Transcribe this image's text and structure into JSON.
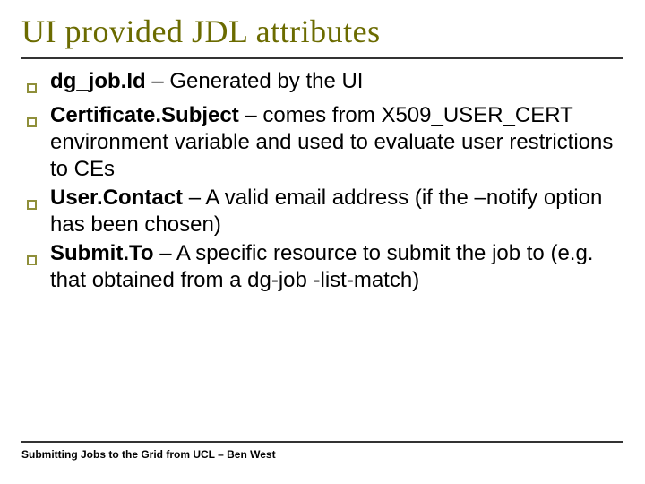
{
  "title": "UI provided JDL attributes",
  "items": [
    {
      "bold": "dg_job.Id",
      "rest": " – Generated by the UI"
    },
    {
      "bold": "Certificate.Subject",
      "rest": " – comes from X509_USER_CERT environment variable and used to evaluate user restrictions to CEs"
    },
    {
      "bold": "User.Contact",
      "rest": " – A valid email address (if the –notify option has been chosen)"
    },
    {
      "bold": "Submit.To",
      "rest": " – A specific resource to submit the job to (e.g. that obtained from a dg-job -list-match)"
    }
  ],
  "footer": "Submitting Jobs to the Grid from UCL – Ben West"
}
